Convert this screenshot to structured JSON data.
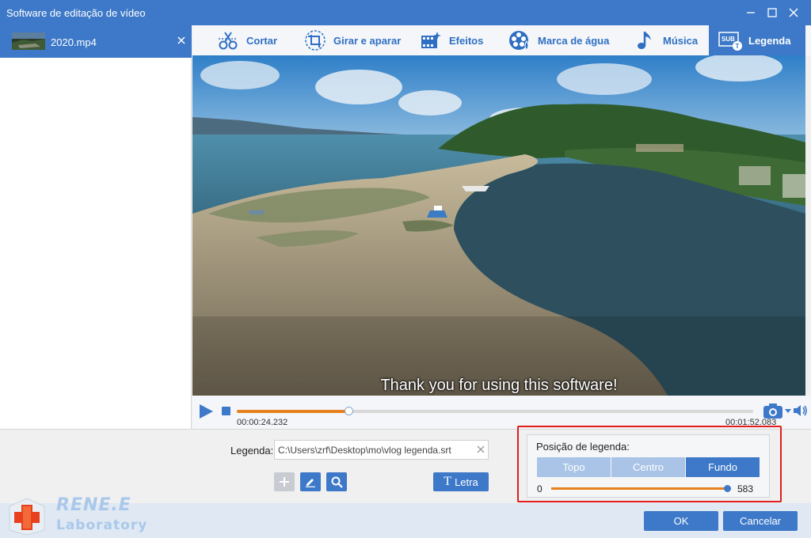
{
  "window": {
    "title": "Software de editação de vídeo"
  },
  "file_list": {
    "items": [
      {
        "name": "2020.mp4"
      }
    ]
  },
  "toolbar": {
    "tabs": [
      {
        "label": "Cortar",
        "icon": "scissors-icon"
      },
      {
        "label": "Girar e aparar",
        "icon": "rotate-crop-icon"
      },
      {
        "label": "Efeitos",
        "icon": "effects-icon"
      },
      {
        "label": "Marca de água",
        "icon": "watermark-icon"
      },
      {
        "label": "Música",
        "icon": "music-note-icon"
      },
      {
        "label": "Legenda",
        "icon": "subtitle-icon"
      }
    ],
    "active_tab": "Legenda"
  },
  "video": {
    "subtitle_text": "Thank you for using this software!"
  },
  "player": {
    "current_time": "00:00:24.232",
    "total_time": "00:01:52.083",
    "progress_fraction": 0.216
  },
  "subtitle_panel": {
    "label": "Legenda:",
    "file_path": "C:\\Users\\zrf\\Desktop\\mo\\vlog legenda.srt",
    "font_button_label": "Letra"
  },
  "position_panel": {
    "title": "Posição de legenda:",
    "options": [
      "Topo",
      "Centro",
      "Fundo"
    ],
    "selected": "Fundo",
    "slider_min": "0",
    "slider_max": "583",
    "slider_value": 570
  },
  "footer": {
    "ok_label": "OK",
    "cancel_label": "Cancelar"
  },
  "logo": {
    "line1": "RENE.E",
    "line2": "Laboratory"
  },
  "colors": {
    "accent": "#3d79c8",
    "progress": "#e8801e",
    "highlight_border": "#e01e1e"
  }
}
